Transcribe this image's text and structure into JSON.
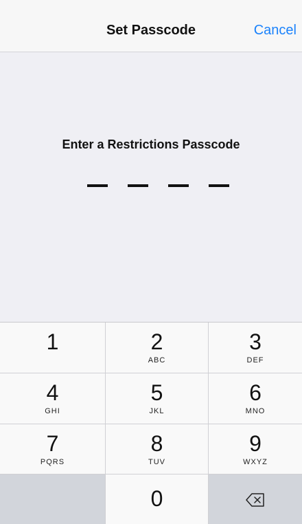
{
  "navbar": {
    "title": "Set Passcode",
    "cancel_label": "Cancel"
  },
  "prompt": {
    "text": "Enter a Restrictions Passcode",
    "passcode_length": 4,
    "entered_digits": 0
  },
  "keypad": {
    "keys": [
      {
        "digit": "1",
        "letters": ""
      },
      {
        "digit": "2",
        "letters": "ABC"
      },
      {
        "digit": "3",
        "letters": "DEF"
      },
      {
        "digit": "4",
        "letters": "GHI"
      },
      {
        "digit": "5",
        "letters": "JKL"
      },
      {
        "digit": "6",
        "letters": "MNO"
      },
      {
        "digit": "7",
        "letters": "PQRS"
      },
      {
        "digit": "8",
        "letters": "TUV"
      },
      {
        "digit": "9",
        "letters": "WXYZ"
      },
      {
        "digit": "0",
        "letters": ""
      }
    ],
    "delete_icon": "backspace-icon"
  },
  "colors": {
    "accent": "#1a82fb",
    "background": "#efeff4",
    "key_background": "#f9f9f9",
    "dark_key_background": "#d2d5db"
  }
}
